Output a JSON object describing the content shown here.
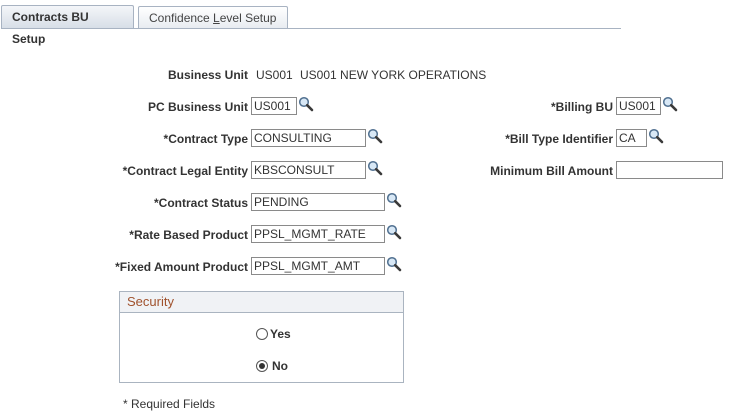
{
  "tabs": [
    {
      "label": "Contracts BU Setup",
      "active": true
    },
    {
      "label_prefix": "Confidence ",
      "label_underlined": "L",
      "label_suffix": "evel Setup",
      "active": false
    }
  ],
  "business_unit": {
    "label": "Business Unit",
    "code": "US001",
    "name": "US001 NEW YORK OPERATIONS"
  },
  "fields": {
    "pc_business_unit": {
      "label": "PC Business Unit",
      "value": "US001"
    },
    "contract_type": {
      "label": "*Contract Type",
      "value": "CONSULTING"
    },
    "contract_legal_entity": {
      "label": "*Contract Legal Entity",
      "value": "KBSCONSULT"
    },
    "contract_status": {
      "label": "*Contract Status",
      "value": "PENDING"
    },
    "rate_based_product": {
      "label": "*Rate Based Product",
      "value": "PPSL_MGMT_RATE"
    },
    "fixed_amount_product": {
      "label": "*Fixed Amount Product",
      "value": "PPSL_MGMT_AMT"
    },
    "billing_bu": {
      "label": "*Billing BU",
      "value": "US001"
    },
    "bill_type_identifier": {
      "label": "*Bill Type Identifier",
      "value": "CA"
    },
    "minimum_bill_amount": {
      "label": "Minimum Bill Amount",
      "value": ""
    }
  },
  "security": {
    "title": "Security",
    "options": [
      {
        "label": "Yes",
        "selected": false
      },
      {
        "label": "No",
        "selected": true
      }
    ]
  },
  "footer": {
    "required_note": "* Required Fields"
  },
  "icons": {
    "lookup": "magnifier-lookup-icon"
  }
}
